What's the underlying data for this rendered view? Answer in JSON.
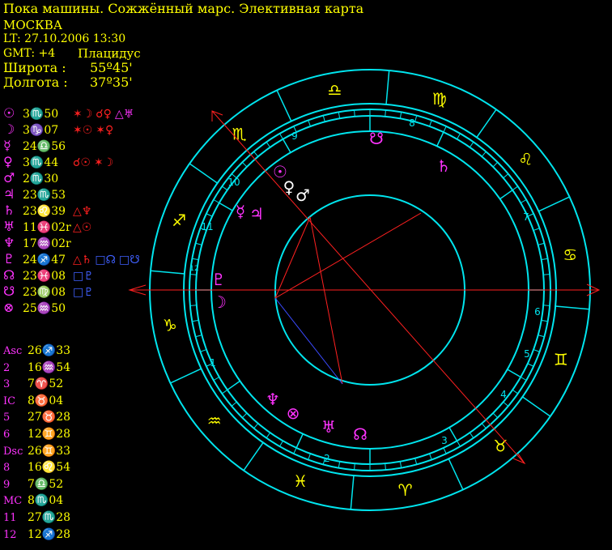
{
  "header": {
    "title": "Пока машины. Сожжённый марс. Элективная карта",
    "city": "МОСКВА",
    "lt": "LT: 27.10.2006  13:30",
    "gmt": "GMT: +4",
    "system": "Плацидус",
    "lat_label": "Широта :",
    "lat_value": "55º45'",
    "lon_label": "Долгота :",
    "lon_value": "37º35'"
  },
  "planets": [
    {
      "glyph": "☉",
      "pos": "3♏50",
      "aspects": [
        {
          "t": "✶☽",
          "c": "red"
        },
        {
          "t": "☌♀",
          "c": "red"
        },
        {
          "t": "△♅",
          "c": "magenta"
        }
      ]
    },
    {
      "glyph": "☽",
      "pos": "3♑07",
      "aspects": [
        {
          "t": "✶☉",
          "c": "red"
        },
        {
          "t": "✶♀",
          "c": "red"
        }
      ]
    },
    {
      "glyph": "☿",
      "pos": "24♎56",
      "aspects": []
    },
    {
      "glyph": "♀",
      "pos": "3♏44",
      "aspects": [
        {
          "t": "☌☉",
          "c": "red"
        },
        {
          "t": "✶☽",
          "c": "red"
        }
      ]
    },
    {
      "glyph": "♂",
      "pos": "2♏30",
      "aspects": []
    },
    {
      "glyph": "♃",
      "pos": "23♏53",
      "aspects": []
    },
    {
      "glyph": "♄",
      "pos": "23♌39",
      "aspects": [
        {
          "t": "△♆",
          "c": "red"
        }
      ]
    },
    {
      "glyph": "♅",
      "pos": "11♓02r",
      "aspects": [
        {
          "t": "△☉",
          "c": "red"
        }
      ]
    },
    {
      "glyph": "♆",
      "pos": "17♒02r",
      "aspects": []
    },
    {
      "glyph": "♇",
      "pos": "24♐47",
      "aspects": [
        {
          "t": "△♄",
          "c": "red"
        },
        {
          "t": "□☊",
          "c": "blue"
        },
        {
          "t": "□☋",
          "c": "blue"
        }
      ]
    },
    {
      "glyph": "☊",
      "pos": "23♓08",
      "aspects": [
        {
          "t": "□♇",
          "c": "blue"
        }
      ]
    },
    {
      "glyph": "☋",
      "pos": "23♍08",
      "aspects": [
        {
          "t": "□♇",
          "c": "blue"
        }
      ]
    },
    {
      "glyph": "⊗",
      "pos": "25♒50",
      "aspects": []
    }
  ],
  "cusps": [
    {
      "label": "Asc",
      "pos": "26♐33"
    },
    {
      "label": "2",
      "pos": "16♒54"
    },
    {
      "label": "3",
      "pos": "7♈52"
    },
    {
      "label": "IC",
      "pos": "8♉04"
    },
    {
      "label": "5",
      "pos": "27♉28"
    },
    {
      "label": "6",
      "pos": "12♊28"
    },
    {
      "label": "Dsc",
      "pos": "26♊33"
    },
    {
      "label": "8",
      "pos": "16♌54"
    },
    {
      "label": "9",
      "pos": "7♎52"
    },
    {
      "label": "MC",
      "pos": "8♏04"
    },
    {
      "label": "11",
      "pos": "27♏28"
    },
    {
      "label": "12",
      "pos": "12♐28"
    }
  ],
  "wheel": {
    "signs": [
      {
        "g": "♎",
        "c": "#ffff00",
        "a": 100
      },
      {
        "g": "♍",
        "c": "#ffff00",
        "a": 70
      },
      {
        "g": "♌",
        "c": "#ffff00",
        "a": 40
      },
      {
        "g": "♋",
        "c": "#ffff00",
        "a": 10
      },
      {
        "g": "♊",
        "c": "#ffff00",
        "a": -20
      },
      {
        "g": "♉",
        "c": "#ffff00",
        "a": -50
      },
      {
        "g": "♈",
        "c": "#ffff00",
        "a": -80
      },
      {
        "g": "♓",
        "c": "#ffff00",
        "a": -110
      },
      {
        "g": "♒",
        "c": "#ffff00",
        "a": -140
      },
      {
        "g": "♑",
        "c": "#ffff00",
        "a": -170
      },
      {
        "g": "♐",
        "c": "#ffff00",
        "a": 160
      },
      {
        "g": "♏",
        "c": "#ffff00",
        "a": 130
      }
    ],
    "house_numbers": [
      "1",
      "2",
      "3",
      "4",
      "5",
      "6",
      "7",
      "8",
      "9",
      "10",
      "11",
      "12"
    ],
    "chart_planets": [
      {
        "g": "☉",
        "c": "#ff33ff"
      },
      {
        "g": "♀",
        "c": "#ffffff"
      },
      {
        "g": "♂",
        "c": "#ffffff"
      },
      {
        "g": "☿",
        "c": "#ff33ff"
      },
      {
        "g": "♃",
        "c": "#ff33ff"
      },
      {
        "g": "♄",
        "c": "#ff33ff"
      },
      {
        "g": "☋",
        "c": "#ff33ff"
      },
      {
        "g": "♇",
        "c": "#ff33ff"
      },
      {
        "g": "☽",
        "c": "#ff33ff"
      },
      {
        "g": "♆",
        "c": "#ff33ff"
      },
      {
        "g": "⊗",
        "c": "#ff33ff"
      },
      {
        "g": "♅",
        "c": "#ff33ff"
      },
      {
        "g": "☊",
        "c": "#ff33ff"
      }
    ]
  },
  "colors": {
    "ring": "#00e5ee",
    "text": "#ffff00",
    "planet": "#ff33ff",
    "red": "#ff2020",
    "blue": "#3a4aff",
    "bg": "#000000"
  }
}
